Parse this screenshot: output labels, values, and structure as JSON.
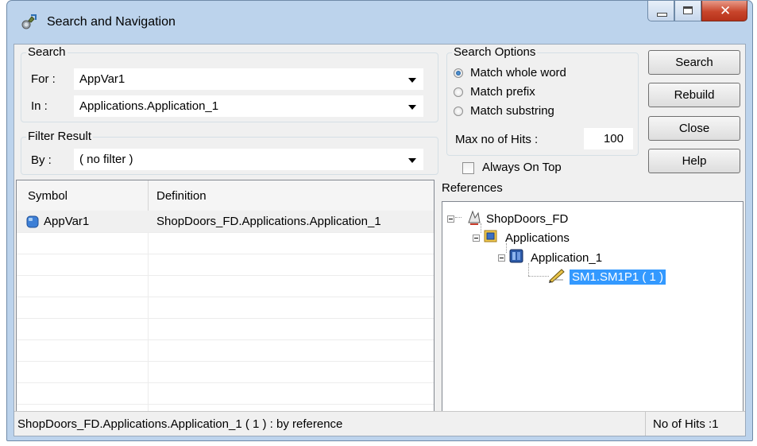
{
  "window": {
    "title": "Search and Navigation"
  },
  "search": {
    "group_label": "Search",
    "for_label": "For :",
    "for_value": "AppVar1",
    "in_label": "In :",
    "in_value": "Applications.Application_1"
  },
  "filter": {
    "group_label": "Filter Result",
    "by_label": "By :",
    "by_value": "( no filter )"
  },
  "options": {
    "group_label": "Search Options",
    "radios": [
      {
        "label": "Match whole word",
        "selected": true
      },
      {
        "label": "Match prefix",
        "selected": false
      },
      {
        "label": "Match substring",
        "selected": false
      }
    ],
    "max_hits_label": "Max no of Hits :",
    "max_hits_value": "100",
    "always_on_top_label": "Always On Top",
    "always_on_top_checked": false
  },
  "buttons": {
    "search": "Search",
    "rebuild": "Rebuild",
    "close": "Close",
    "help": "Help"
  },
  "results": {
    "columns": [
      "Symbol",
      "Definition"
    ],
    "rows": [
      {
        "symbol": "AppVar1",
        "definition": "ShopDoors_FD.Applications.Application_1"
      }
    ]
  },
  "references": {
    "label": "References",
    "tree": [
      {
        "label": "ShopDoors_FD",
        "icon": "project-icon"
      },
      {
        "label": "Applications",
        "icon": "applications-folder-icon"
      },
      {
        "label": "Application_1",
        "icon": "application-icon"
      },
      {
        "label": "SM1.SM1P1 ( 1 )",
        "icon": "pencil-reference-icon",
        "selected": true
      }
    ]
  },
  "status": {
    "left": "ShopDoors_FD.Applications.Application_1 ( 1 ) : by reference",
    "right": "No of Hits :1"
  },
  "colors": {
    "selection": "#3399ff",
    "title_bar": "#bcd3ec",
    "close_button": "#c8452b"
  }
}
